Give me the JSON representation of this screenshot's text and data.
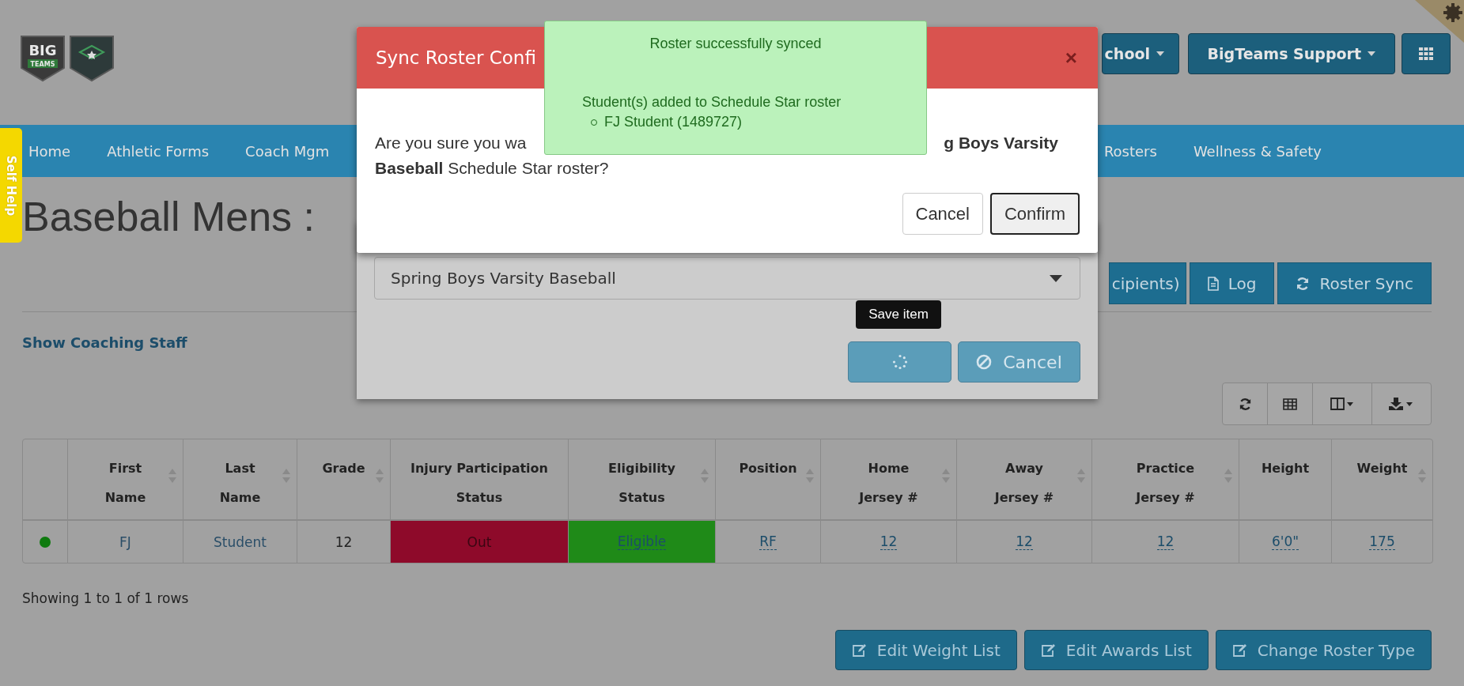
{
  "logo": {
    "line1": "BIG",
    "line2": "TEAMS"
  },
  "header": {
    "buttons": [
      {
        "label": "chool"
      },
      {
        "label": "BigTeams Support"
      }
    ]
  },
  "self_help": "Self Help",
  "nav": {
    "left": [
      "Home",
      "Athletic Forms",
      "Coach Mgm"
    ],
    "right": [
      "Rosters",
      "Wellness & Safety"
    ]
  },
  "page": {
    "title": "Baseball Mens :",
    "actions": [
      {
        "label": "cipients)"
      },
      {
        "label": "Log"
      },
      {
        "label": "Roster Sync"
      }
    ],
    "link": "Show Coaching Staff"
  },
  "table": {
    "columns": [
      {
        "sortable": false
      },
      {
        "label": "First Name",
        "sortable": true
      },
      {
        "label": "Last Name",
        "sortable": true
      },
      {
        "label": "Grade",
        "sortable": true
      },
      {
        "label": "Injury Participation Status",
        "sortable": false
      },
      {
        "label": "Eligibility Status",
        "sortable": true
      },
      {
        "label": "Position",
        "sortable": true
      },
      {
        "label": "Home Jersey #",
        "sortable": true
      },
      {
        "label": "Away Jersey #",
        "sortable": true
      },
      {
        "label": "Practice Jersey #",
        "sortable": true
      },
      {
        "label": "Height",
        "sortable": false
      },
      {
        "label": "Weight",
        "sortable": true
      }
    ],
    "rows": [
      {
        "cells": [
          {
            "kind": "status",
            "color": "#0f7a0f"
          },
          {
            "text": "FJ",
            "kind": "link"
          },
          {
            "text": "Student",
            "kind": "link"
          },
          {
            "text": "12",
            "kind": "plain"
          },
          {
            "text": "Out",
            "kind": "danger"
          },
          {
            "text": "Eligible",
            "kind": "success"
          },
          {
            "text": "RF",
            "kind": "editable"
          },
          {
            "text": "12",
            "kind": "editable"
          },
          {
            "text": "12",
            "kind": "editable"
          },
          {
            "text": "12",
            "kind": "editable"
          },
          {
            "text": "6'0\"",
            "kind": "editable"
          },
          {
            "text": "175",
            "kind": "editable"
          }
        ]
      }
    ]
  },
  "footer": {
    "summary": "Showing 1 to 1 of 1 rows",
    "buttons": [
      "Edit Weight List",
      "Edit Awards List",
      "Change Roster Type"
    ]
  },
  "edit_modal": {
    "select": "Spring Boys Varsity Baseball",
    "cancel": "Cancel",
    "tooltip": "Save item"
  },
  "confirm_modal": {
    "title": "Sync Roster Confi",
    "close": "×",
    "body_left": "Are you sure you wa",
    "body_right": "g Boys Varsity",
    "body_line2": "**Baseball** Schedule Star roster?",
    "buttons": [
      {
        "label": "Cancel",
        "focused": false
      },
      {
        "label": "Confirm",
        "focused": true
      }
    ]
  },
  "toast": {
    "title": "Roster successfully synced",
    "message": "Student(s) added to Schedule Star roster",
    "items": [
      "FJ Student (1489727)"
    ]
  }
}
